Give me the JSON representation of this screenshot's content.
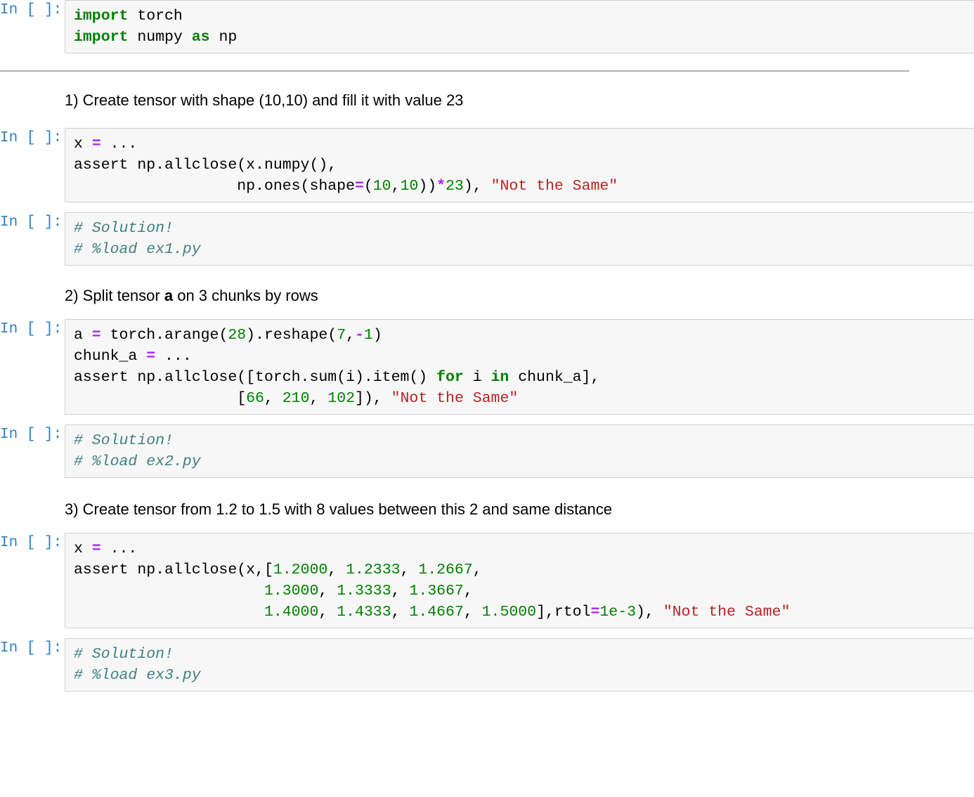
{
  "notebook": {
    "prompt_label": "In [ ]:",
    "colors": {
      "keyword": "#008000",
      "number": "#008000",
      "operator": "#aa22ff",
      "string": "#ba2121",
      "comment": "#408080",
      "prompt": "#307fc1",
      "cell_background": "#f7f7f7",
      "cell_border": "#cfcfcf",
      "divider": "#b0b0b0",
      "page_background": "#ffffff"
    },
    "cells": [
      {
        "type": "code",
        "name": "imports-cell",
        "lines": [
          [
            {
              "t": "import",
              "c": "k"
            },
            {
              "t": " torch",
              "c": "p"
            }
          ],
          [
            {
              "t": "import",
              "c": "k"
            },
            {
              "t": " numpy ",
              "c": "p"
            },
            {
              "t": "as",
              "c": "k"
            },
            {
              "t": " np",
              "c": "p"
            }
          ]
        ]
      },
      {
        "type": "divider",
        "name": "section-divider"
      },
      {
        "type": "markdown",
        "name": "exercise-1-prompt",
        "html": "1) Create tensor with shape (10,10) and fill it with value 23"
      },
      {
        "type": "code",
        "name": "exercise-1-cell",
        "lines": [
          [
            {
              "t": "x ",
              "c": "p"
            },
            {
              "t": "=",
              "c": "o"
            },
            {
              "t": " ...",
              "c": "p"
            }
          ],
          [
            {
              "t": "assert np.allclose(x.numpy(),",
              "c": "p"
            }
          ],
          [
            {
              "t": "                  np.ones(shape",
              "c": "p"
            },
            {
              "t": "=",
              "c": "o"
            },
            {
              "t": "(",
              "c": "p"
            },
            {
              "t": "10",
              "c": "n"
            },
            {
              "t": ",",
              "c": "p"
            },
            {
              "t": "10",
              "c": "n"
            },
            {
              "t": "))",
              "c": "p"
            },
            {
              "t": "*",
              "c": "o"
            },
            {
              "t": "23",
              "c": "n"
            },
            {
              "t": "), ",
              "c": "p"
            },
            {
              "t": "\"Not the Same\"",
              "c": "s"
            }
          ]
        ]
      },
      {
        "type": "code",
        "name": "exercise-1-solution-cell",
        "lines": [
          [
            {
              "t": "# Solution!",
              "c": "c"
            }
          ],
          [
            {
              "t": "# %load ex1.py",
              "c": "c"
            }
          ]
        ]
      },
      {
        "type": "markdown",
        "name": "exercise-2-prompt",
        "html": "2) Split tensor <b>a</b> on 3 chunks by rows"
      },
      {
        "type": "code",
        "name": "exercise-2-cell",
        "lines": [
          [
            {
              "t": "a ",
              "c": "p"
            },
            {
              "t": "=",
              "c": "o"
            },
            {
              "t": " torch.arange(",
              "c": "p"
            },
            {
              "t": "28",
              "c": "n"
            },
            {
              "t": ").reshape(",
              "c": "p"
            },
            {
              "t": "7",
              "c": "n"
            },
            {
              "t": ",",
              "c": "p"
            },
            {
              "t": "-",
              "c": "o"
            },
            {
              "t": "1",
              "c": "n"
            },
            {
              "t": ")",
              "c": "p"
            }
          ],
          [
            {
              "t": "chunk_a ",
              "c": "p"
            },
            {
              "t": "=",
              "c": "o"
            },
            {
              "t": " ...",
              "c": "p"
            }
          ],
          [
            {
              "t": "assert np.allclose([torch.sum(i).item() ",
              "c": "p"
            },
            {
              "t": "for",
              "c": "k"
            },
            {
              "t": " i ",
              "c": "p"
            },
            {
              "t": "in",
              "c": "k"
            },
            {
              "t": " chunk_a],",
              "c": "p"
            }
          ],
          [
            {
              "t": "                  [",
              "c": "p"
            },
            {
              "t": "66",
              "c": "n"
            },
            {
              "t": ", ",
              "c": "p"
            },
            {
              "t": "210",
              "c": "n"
            },
            {
              "t": ", ",
              "c": "p"
            },
            {
              "t": "102",
              "c": "n"
            },
            {
              "t": "]), ",
              "c": "p"
            },
            {
              "t": "\"Not the Same\"",
              "c": "s"
            }
          ]
        ]
      },
      {
        "type": "code",
        "name": "exercise-2-solution-cell",
        "lines": [
          [
            {
              "t": "# Solution!",
              "c": "c"
            }
          ],
          [
            {
              "t": "# %load ex2.py",
              "c": "c"
            }
          ]
        ]
      },
      {
        "type": "markdown",
        "name": "exercise-3-prompt",
        "html": "3) Create tensor from 1.2 to 1.5 with 8 values between this 2 and same distance"
      },
      {
        "type": "code",
        "name": "exercise-3-cell",
        "lines": [
          [
            {
              "t": "x ",
              "c": "p"
            },
            {
              "t": "=",
              "c": "o"
            },
            {
              "t": " ...",
              "c": "p"
            }
          ],
          [
            {
              "t": "assert np.allclose(x,[",
              "c": "p"
            },
            {
              "t": "1.2000",
              "c": "n"
            },
            {
              "t": ", ",
              "c": "p"
            },
            {
              "t": "1.2333",
              "c": "n"
            },
            {
              "t": ", ",
              "c": "p"
            },
            {
              "t": "1.2667",
              "c": "n"
            },
            {
              "t": ",",
              "c": "p"
            }
          ],
          [
            {
              "t": "                     ",
              "c": "p"
            },
            {
              "t": "1.3000",
              "c": "n"
            },
            {
              "t": ", ",
              "c": "p"
            },
            {
              "t": "1.3333",
              "c": "n"
            },
            {
              "t": ", ",
              "c": "p"
            },
            {
              "t": "1.3667",
              "c": "n"
            },
            {
              "t": ",",
              "c": "p"
            }
          ],
          [
            {
              "t": "                     ",
              "c": "p"
            },
            {
              "t": "1.4000",
              "c": "n"
            },
            {
              "t": ", ",
              "c": "p"
            },
            {
              "t": "1.4333",
              "c": "n"
            },
            {
              "t": ", ",
              "c": "p"
            },
            {
              "t": "1.4667",
              "c": "n"
            },
            {
              "t": ", ",
              "c": "p"
            },
            {
              "t": "1.5000",
              "c": "n"
            },
            {
              "t": "],rtol",
              "c": "p"
            },
            {
              "t": "=",
              "c": "o"
            },
            {
              "t": "1e-3",
              "c": "n"
            },
            {
              "t": "), ",
              "c": "p"
            },
            {
              "t": "\"Not the Same\"",
              "c": "s"
            }
          ]
        ]
      },
      {
        "type": "code",
        "name": "exercise-3-solution-cell",
        "lines": [
          [
            {
              "t": "# Solution!",
              "c": "c"
            }
          ],
          [
            {
              "t": "# %load ex3.py",
              "c": "c"
            }
          ]
        ]
      }
    ]
  }
}
